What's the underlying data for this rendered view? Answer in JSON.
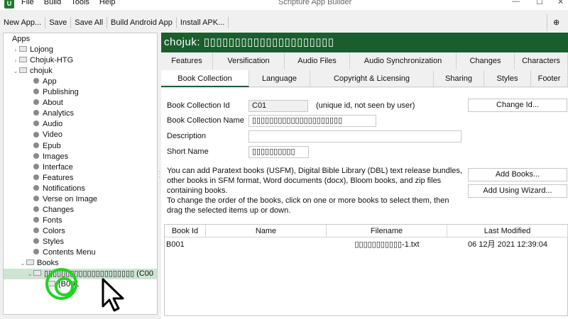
{
  "app": {
    "icon_text": "U",
    "window_title": "Scripture App Builder"
  },
  "menu": [
    "File",
    "Build",
    "Tools",
    "Help"
  ],
  "toolbar": [
    "New App...",
    "Save",
    "Save All",
    "Build Android App",
    "Install APK...",
    "EN"
  ],
  "tree": [
    {
      "label": "Apps",
      "arrow": "",
      "icon": "none",
      "indent": 0
    },
    {
      "label": "Lojong",
      "arrow": "›",
      "icon": "fold",
      "indent": 1
    },
    {
      "label": "Chojuk-HTG",
      "arrow": "›",
      "icon": "fold",
      "indent": 1
    },
    {
      "label": "chojuk",
      "arrow": "⌄",
      "icon": "fold",
      "indent": 1
    },
    {
      "label": "App",
      "arrow": "",
      "icon": "dot",
      "indent": 3
    },
    {
      "label": "Publishing",
      "arrow": "",
      "icon": "dot",
      "indent": 3
    },
    {
      "label": "About",
      "arrow": "",
      "icon": "dot",
      "indent": 3
    },
    {
      "label": "Analytics",
      "arrow": "",
      "icon": "dot",
      "indent": 3
    },
    {
      "label": "Audio",
      "arrow": "",
      "icon": "dot",
      "indent": 3
    },
    {
      "label": "Video",
      "arrow": "",
      "icon": "dot",
      "indent": 3
    },
    {
      "label": "Epub",
      "arrow": "",
      "icon": "dot",
      "indent": 3
    },
    {
      "label": "Images",
      "arrow": "",
      "icon": "dot",
      "indent": 3
    },
    {
      "label": "Interface",
      "arrow": "",
      "icon": "dot",
      "indent": 3
    },
    {
      "label": "Features",
      "arrow": "",
      "icon": "dot",
      "indent": 3
    },
    {
      "label": "Notifications",
      "arrow": "",
      "icon": "dot",
      "indent": 3
    },
    {
      "label": "Verse on Image",
      "arrow": "",
      "icon": "dot",
      "indent": 3
    },
    {
      "label": "Changes",
      "arrow": "",
      "icon": "dot",
      "indent": 3
    },
    {
      "label": "Fonts",
      "arrow": "",
      "icon": "dot",
      "indent": 3
    },
    {
      "label": "Colors",
      "arrow": "",
      "icon": "dot",
      "indent": 3
    },
    {
      "label": "Styles",
      "arrow": "",
      "icon": "dot",
      "indent": 3
    },
    {
      "label": "Contents Menu",
      "arrow": "",
      "icon": "dot",
      "indent": 3
    },
    {
      "label": "Books",
      "arrow": "⌄",
      "icon": "fold",
      "indent": 2
    },
    {
      "label": "▯▯▯▯▯▯▯▯▯▯▯▯▯▯▯▯▯▯▯▯▯ (C00",
      "arrow": "⌄",
      "icon": "fold",
      "indent": 3,
      "selected": true
    },
    {
      "label": "(B001",
      "arrow": "",
      "icon": "fold",
      "indent": 5
    }
  ],
  "header": {
    "title": "chojuk: ▯▯▯▯▯▯▯▯▯▯▯▯▯▯▯▯▯▯▯▯▯"
  },
  "tabs_row1": [
    "Features",
    "Versification",
    "Audio Files",
    "Audio Synchronization",
    "Changes",
    "Characters"
  ],
  "tabs_row2": [
    "Book Collection",
    "Language",
    "Copyright & Licensing",
    "Sharing",
    "Styles",
    "Footer"
  ],
  "active_tab": "Book Collection",
  "form": {
    "id_label": "Book Collection Id",
    "id_value": "C01",
    "id_note": "(unique id, not seen by user)",
    "change_id": "Change Id...",
    "name_label": "Book Collection Name",
    "name_value": "▯▯▯▯▯▯▯▯▯▯▯▯▯▯▯▯▯▯▯▯▯",
    "desc_label": "Description",
    "desc_value": "",
    "short_label": "Short Name",
    "short_value": "▯▯▯▯▯▯▯▯▯▯",
    "info1": "You can add Paratext books (USFM), Digital Bible Library (DBL) text release bundles, other books in SFM format, Word documents (docx), Bloom books, and zip files containing books.",
    "info2": "To change the order of the books, click on one or more books to select them, then drag the selected items up or down.",
    "add_books": "Add Books...",
    "add_wizard": "Add Using Wizard..."
  },
  "books_table": {
    "columns": [
      "Book Id",
      "Name",
      "Filename",
      "Last Modified"
    ],
    "rows": [
      [
        "B001",
        "",
        "▯▯▯▯▯▯▯▯▯▯▯-1.txt",
        "06 12月 2021 12:39:04"
      ]
    ]
  },
  "colors": {
    "accent": "#1b5e2d",
    "selection": "#cfe4d3",
    "click_indicator": "#22d422"
  }
}
